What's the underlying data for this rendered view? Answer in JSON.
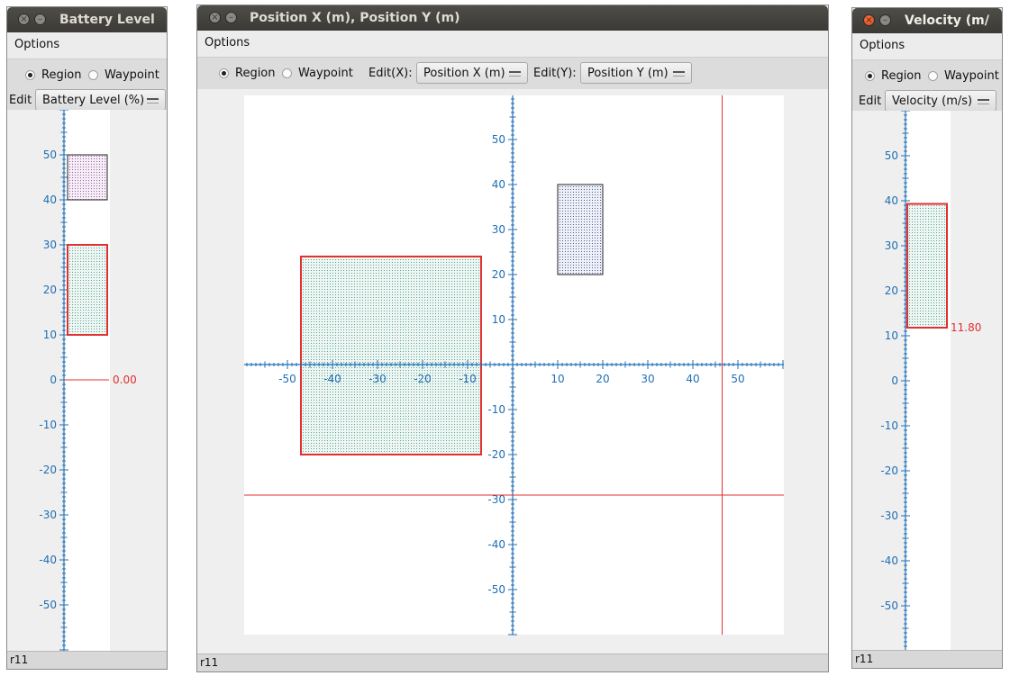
{
  "windows": {
    "battery": {
      "title": "Battery Level",
      "menu": "Options",
      "radio_region": "Region",
      "radio_waypoint": "Waypoint",
      "edit_label": "Edit",
      "edit_value": "Battery Level (%)",
      "current_value": "0.00",
      "status": "r11"
    },
    "position": {
      "title": "Position X (m), Position Y (m)",
      "menu": "Options",
      "radio_region": "Region",
      "radio_waypoint": "Waypoint",
      "edit_x_label": "Edit(X):",
      "edit_x_value": "Position X (m)",
      "edit_y_label": "Edit(Y):",
      "edit_y_value": "Position Y (m)",
      "status": "r11"
    },
    "velocity": {
      "title": "Velocity (m/",
      "menu": "Options",
      "radio_region": "Region",
      "radio_waypoint": "Waypoint",
      "edit_label": "Edit",
      "edit_value": "Velocity (m/s)",
      "current_value": "11.80",
      "status": "r11"
    }
  },
  "colors": {
    "axis": "#1f6fb4",
    "selected": "#e03030",
    "cursor": "#e03030"
  },
  "chart_data": [
    {
      "type": "region-plot-1d",
      "axis": "y",
      "ylim": [
        -60,
        60
      ],
      "tick_labels": [
        -50,
        -40,
        -30,
        -20,
        -10,
        0,
        10,
        20,
        30,
        40,
        50
      ],
      "regions": [
        {
          "y": [
            40,
            50
          ],
          "selected": false
        },
        {
          "y": [
            10,
            30
          ],
          "selected": true
        }
      ],
      "current_value": 0.0
    },
    {
      "type": "region-plot-2d",
      "xlim": [
        -60,
        60
      ],
      "ylim": [
        -60,
        60
      ],
      "x_tick_labels": [
        -50,
        -40,
        -30,
        -20,
        -10,
        10,
        20,
        30,
        40,
        50
      ],
      "y_tick_labels": [
        -50,
        -40,
        -30,
        -20,
        -10,
        10,
        20,
        30,
        40,
        50
      ],
      "regions": [
        {
          "x": [
            10,
            20
          ],
          "y": [
            20,
            40
          ],
          "selected": false
        },
        {
          "x": [
            -47,
            -7
          ],
          "y": [
            -20,
            24
          ],
          "selected": true
        }
      ],
      "cursor": {
        "x": 46.5,
        "y": -29
      }
    },
    {
      "type": "region-plot-1d",
      "axis": "y",
      "ylim": [
        -60,
        60
      ],
      "tick_labels": [
        -50,
        -40,
        -30,
        -20,
        -10,
        0,
        10,
        20,
        30,
        40,
        50
      ],
      "regions": [
        {
          "y": [
            11.8,
            39.3
          ],
          "selected": true
        }
      ],
      "current_value": 11.8
    }
  ]
}
